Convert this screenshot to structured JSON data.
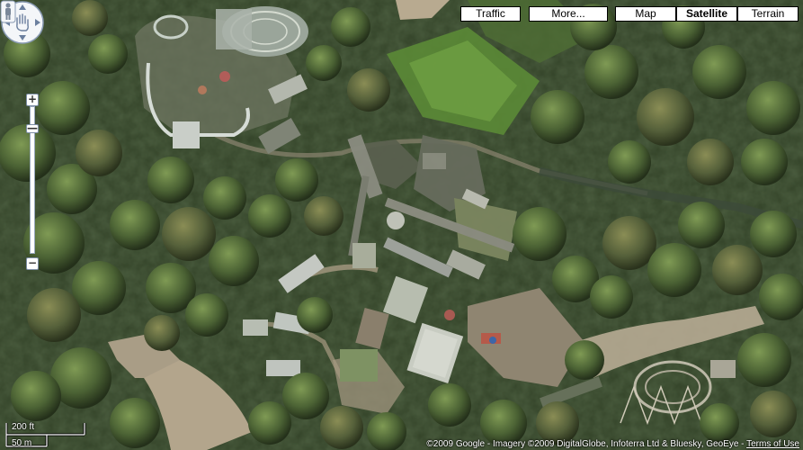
{
  "map": {
    "view": "satellite",
    "controls": {
      "buttons": [
        {
          "label": "Traffic",
          "active": false
        },
        {
          "label": "More...",
          "active": false
        },
        {
          "label": "Map",
          "active": false
        },
        {
          "label": "Satellite",
          "active": true
        },
        {
          "label": "Terrain",
          "active": false
        }
      ],
      "zoom_in_symbol": "+",
      "zoom_out_symbol": "−",
      "zoom_level_fraction": 0.5
    },
    "scale": {
      "imperial": "200 ft",
      "metric": "50 m"
    },
    "attribution": {
      "text": "©2009 Google - Imagery ©2009 DigitalGlobe, Infoterra Ltd & Bluesky, GeoEye - ",
      "terms_link": "Terms of Use"
    },
    "colors": {
      "forest_dark": "#2e3a23",
      "forest_mid": "#4d6136",
      "canopy_light": "#6f8a4a",
      "lawn": "#5f8f3a",
      "path": "#a89a82",
      "roof_light": "#c8ccc4"
    }
  }
}
